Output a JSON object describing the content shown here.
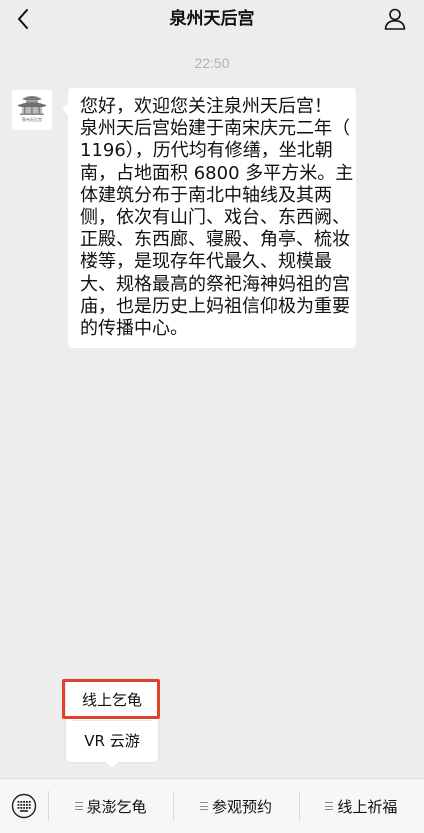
{
  "header": {
    "title": "泉州天后宫",
    "back_icon": "chevron-left-icon",
    "profile_icon": "person-icon"
  },
  "chat": {
    "timestamp": "22:50",
    "message": {
      "avatar_logo_text": "泉州天后宫",
      "lines": [
        "您好，欢迎您关注泉州天后宫！",
        "泉州天后宫始建于南宋庆元二年（",
        "1196），历代均有修缮，坐北朝",
        "南，占地面积 6800 多平方米。主",
        "体建筑分布于南北中轴线及其两",
        "侧，依次有山门、戏台、东西阙、",
        "正殿、东西廊、寝殿、角亭、梳妆",
        "楼等，是现存年代最久、规模最",
        "大、规格最高的祭祀海神妈祖的宫",
        "庙，也是历史上妈祖信仰极为重要",
        "的传播中心。"
      ]
    }
  },
  "submenu": {
    "items": [
      "线上乞龟",
      "VR 云游"
    ]
  },
  "bottom_menu": {
    "keyboard_icon": "keyboard-icon",
    "items": [
      {
        "label": "泉澎乞龟",
        "icon": "menu-lines-icon"
      },
      {
        "label": "参观预约",
        "icon": "menu-lines-icon"
      },
      {
        "label": "线上祈福",
        "icon": "menu-lines-icon"
      }
    ]
  },
  "colors": {
    "background": "#ededed",
    "bubble": "#ffffff",
    "text": "#111111",
    "timestamp": "#b2b2b2",
    "highlight": "#e0432c",
    "bottom_bar": "#f7f7f7"
  }
}
